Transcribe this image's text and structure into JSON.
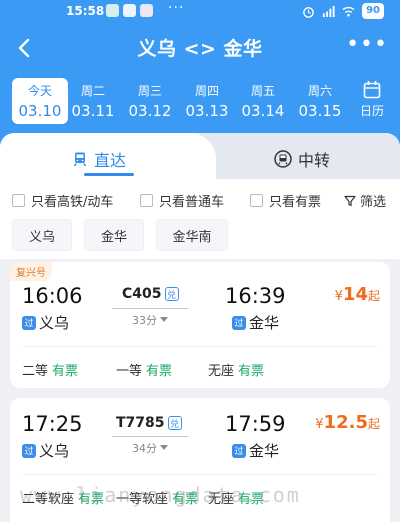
{
  "status_bar": {
    "time": "15:58",
    "dots": "···",
    "battery": "90",
    "app_icons": [
      "wechat-icon",
      "bubble-icon",
      "video-app-icon"
    ]
  },
  "header": {
    "title": "义乌 <> 金华",
    "more": "•••"
  },
  "dates": [
    {
      "weekday": "今天",
      "date": "03.10",
      "active": true
    },
    {
      "weekday": "周二",
      "date": "03.11"
    },
    {
      "weekday": "周三",
      "date": "03.12"
    },
    {
      "weekday": "周四",
      "date": "03.13"
    },
    {
      "weekday": "周五",
      "date": "03.14"
    },
    {
      "weekday": "周六",
      "date": "03.15"
    }
  ],
  "calendar_label": "日历",
  "tabs": {
    "direct": "直达",
    "transfer": "中转"
  },
  "filters": {
    "high_speed": "只看高铁/动车",
    "normal": "只看普通车",
    "available": "只看有票",
    "filter": "筛选"
  },
  "stations": [
    "义乌",
    "金华",
    "金华南"
  ],
  "trains": [
    {
      "tag": "复兴号",
      "dep_time": "16:06",
      "arr_time": "16:39",
      "train_no": "C405",
      "ticket_mark": "兑",
      "duration": "33分",
      "pass_mark": "过",
      "dep_station": "义乌",
      "arr_station": "金华",
      "price_symbol": "¥",
      "price": "14",
      "price_suffix": "起",
      "seats": [
        {
          "name": "二等",
          "status": "有票"
        },
        {
          "name": "一等",
          "status": "有票"
        },
        {
          "name": "无座",
          "status": "有票"
        }
      ]
    },
    {
      "dep_time": "17:25",
      "arr_time": "17:59",
      "train_no": "T7785",
      "ticket_mark": "兑",
      "duration": "34分",
      "pass_mark": "过",
      "dep_station": "义乌",
      "arr_station": "金华",
      "price_symbol": "¥",
      "price": "12.5",
      "price_suffix": "起",
      "seats": [
        {
          "name": "二等软座",
          "status": "有票"
        },
        {
          "name": "一等软座",
          "status": "有票"
        },
        {
          "name": "无座",
          "status": "有票"
        }
      ]
    }
  ],
  "watermark": "www.lianyongdata.com",
  "colors": {
    "primary": "#3b9af4",
    "price": "#f06b1d",
    "available": "#1aab68"
  }
}
